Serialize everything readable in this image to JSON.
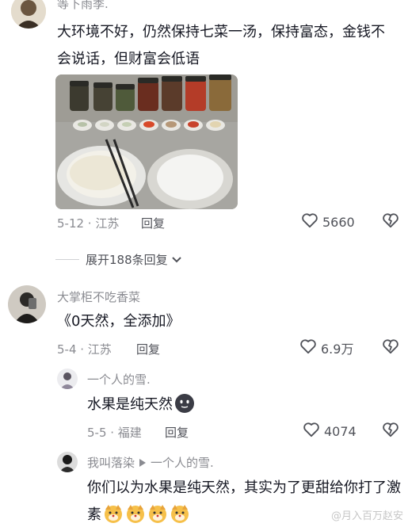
{
  "comments": {
    "c1": {
      "username": "等下雨季.",
      "text": "大环境不好，仍然保持七菜一汤，保持富态，金钱不会说话，但财富会低语",
      "date_loc": "5-12 · 江苏",
      "reply_label": "回复",
      "likes": "5660"
    },
    "expand_label": "展开188条回复",
    "c2": {
      "username": "大掌柜不吃香菜",
      "text": "《0天然，全添加》",
      "date_loc": "5-4 · 江苏",
      "reply_label": "回复",
      "likes": "6.9万"
    },
    "r1": {
      "username": "一个人的雪.",
      "text": "水果是纯天然",
      "date_loc": "5-5 · 福建",
      "reply_label": "回复",
      "likes": "4074"
    },
    "r2": {
      "username": "我叫落染",
      "reply_to": "一个人的雪.",
      "text": "你们以为水果是纯天然，其实为了更甜给你打了激素"
    }
  },
  "watermark": "@月入百万赵安",
  "icons": {
    "like": "heart-outline-icon",
    "dislike": "broken-heart-icon",
    "expand": "chevron-down-icon",
    "reply_arrow": "triangle-right-icon",
    "emoji1": "smiling-face-emoji",
    "emoji2": "dog-emoji"
  },
  "colors": {
    "text": "#161823",
    "muted": "#8a8b91",
    "action": "#505259"
  }
}
